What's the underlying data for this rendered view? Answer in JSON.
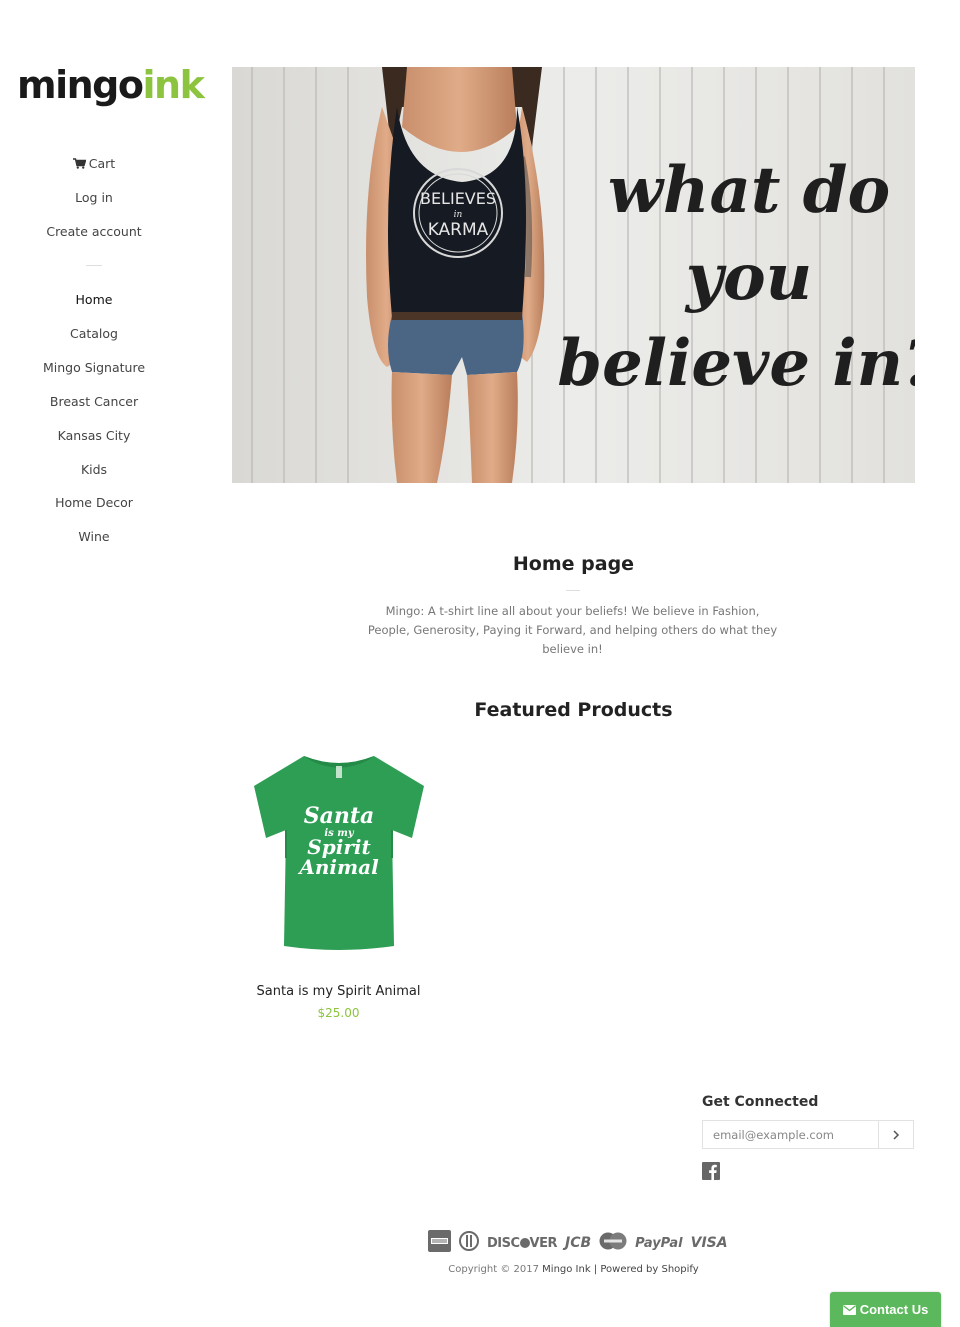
{
  "brand": {
    "part1": "mingo",
    "part2": "ink",
    "accent_color": "#8cc43f"
  },
  "account_nav": [
    {
      "label": "Cart",
      "icon": "cart-icon"
    },
    {
      "label": "Log in"
    },
    {
      "label": "Create account"
    }
  ],
  "main_nav": [
    {
      "label": "Home",
      "active": true
    },
    {
      "label": "Catalog"
    },
    {
      "label": "Mingo Signature"
    },
    {
      "label": "Breast Cancer"
    },
    {
      "label": "Kansas City"
    },
    {
      "label": "Kids"
    },
    {
      "label": "Home Decor"
    },
    {
      "label": "Wine"
    }
  ],
  "hero": {
    "shirt_text_top": "BELIEVES",
    "shirt_text_mid": "in",
    "shirt_text_bottom": "KARMA",
    "script_line1": "what do",
    "script_line2": "you",
    "script_line3": "believe in?"
  },
  "home": {
    "title": "Home page",
    "description": "Mingo: A t-shirt line all about your beliefs! We believe in Fashion, People, Generosity, Paying it Forward, and helping others do what they believe in!"
  },
  "featured": {
    "title": "Featured Products",
    "products": [
      {
        "name": "Santa is my Spirit Animal",
        "price": "$25.00",
        "shirt_color": "#2e9e55",
        "print_line1": "Santa",
        "print_line2": "is my",
        "print_line3": "Spirit",
        "print_line4": "Animal"
      }
    ]
  },
  "footer": {
    "get_connected": "Get Connected",
    "email_placeholder": "email@example.com",
    "payments": [
      "AMERICAN EXPRESS",
      "DINERS",
      "DISCOVER",
      "JCB",
      "MASTERCARD",
      "PayPal",
      "VISA"
    ],
    "copyright_prefix": "Copyright © 2017 ",
    "store_name": "Mingo Ink",
    "separator": " | ",
    "powered_by": "Powered by Shopify"
  },
  "contact_button": {
    "label": "Contact Us",
    "color": "#5cb85c"
  }
}
